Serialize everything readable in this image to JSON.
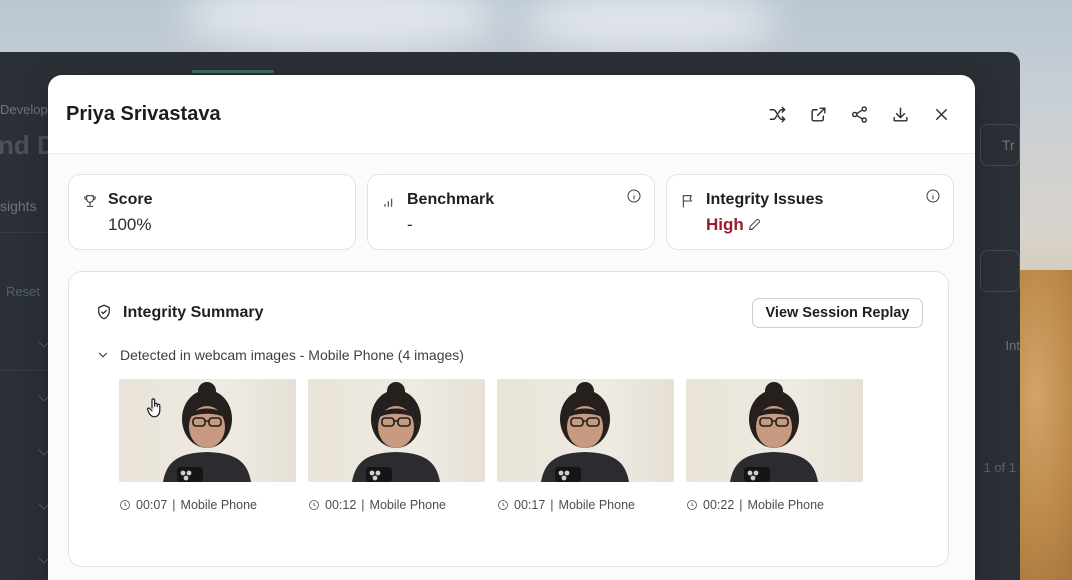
{
  "background": {
    "breadcrumb": "Develope",
    "heading": "nd D",
    "tab": "sights",
    "reset": "Reset",
    "try_button": "Tr",
    "column": "Int",
    "pager": "1 of 1"
  },
  "modal": {
    "title": "Priya Srivastava",
    "header_icons": [
      "shuffle-icon",
      "open-external-icon",
      "share-icon",
      "download-icon",
      "close-icon"
    ]
  },
  "cards": [
    {
      "icon": "trophy-icon",
      "label": "Score",
      "value": "100%",
      "has_info": false
    },
    {
      "icon": "bar-chart-icon",
      "label": "Benchmark",
      "value": "-",
      "has_info": true
    },
    {
      "icon": "flag-icon",
      "label": "Integrity Issues",
      "value": "High",
      "has_info": true,
      "value_color": "#9b1b2c"
    }
  ],
  "summary": {
    "title": "Integrity Summary",
    "replay_button": "View Session Replay",
    "detected_label": "Detected in webcam images - Mobile Phone (4 images)",
    "images": [
      {
        "time": "00:07",
        "label": "Mobile Phone"
      },
      {
        "time": "00:12",
        "label": "Mobile Phone"
      },
      {
        "time": "00:17",
        "label": "Mobile Phone"
      },
      {
        "time": "00:22",
        "label": "Mobile Phone"
      }
    ],
    "separator": "|"
  }
}
